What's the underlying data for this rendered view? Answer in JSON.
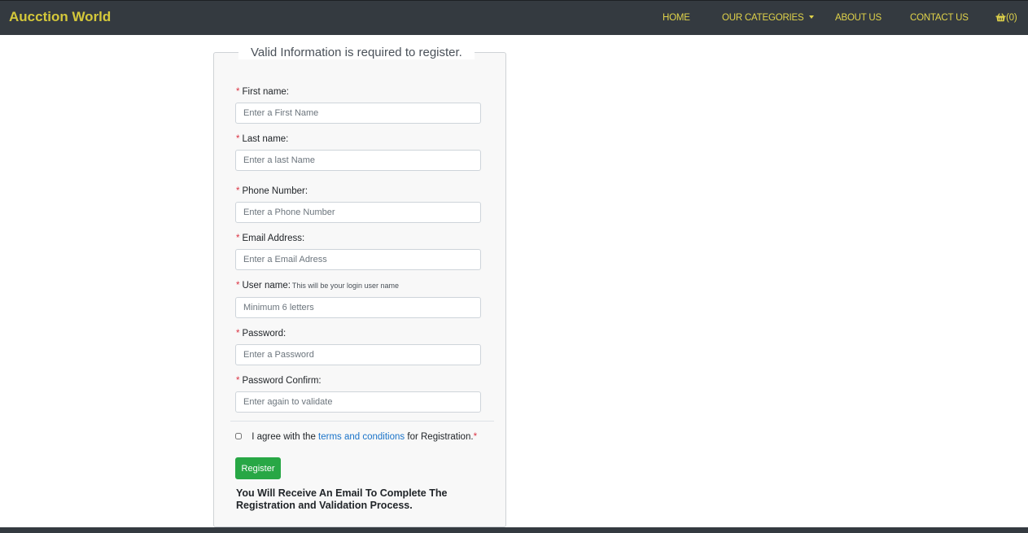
{
  "navbar": {
    "brand": "Aucction World",
    "links": {
      "home": "HOME",
      "categories": "OUR CATEGORIES",
      "about": "ABOUT US",
      "contact": "CONTACT US",
      "cart_count": "(0)"
    },
    "cart_icon": "basket-icon",
    "colors": {
      "background": "#343a40",
      "accent": "#d4c83a"
    }
  },
  "form": {
    "legend": "Valid Information is required to register.",
    "required_marker": "*",
    "fields": {
      "first_name": {
        "label": "First name:",
        "placeholder": "Enter a First Name"
      },
      "last_name": {
        "label": "Last name:",
        "placeholder": "Enter a last Name"
      },
      "phone": {
        "label": "Phone Number:",
        "placeholder": "Enter a Phone Number"
      },
      "email": {
        "label": "Email Address:",
        "placeholder": "Enter a Email Adress"
      },
      "username": {
        "label": "User name:",
        "hint": "This will be your login user name",
        "placeholder": "Minimum 6 letters"
      },
      "password": {
        "label": "Password:",
        "placeholder": "Enter a Password"
      },
      "password_confirm": {
        "label": "Password Confirm:",
        "placeholder": "Enter again to validate"
      }
    },
    "agree": {
      "prefix": "I agree with the",
      "link": "terms and conditions",
      "suffix": "for Registration.",
      "required_marker": "*",
      "checked": false
    },
    "register_label": "Register",
    "register_color": "#28a745",
    "notice": "You Will Receive An Email To Complete The Registration and Validation Process."
  }
}
